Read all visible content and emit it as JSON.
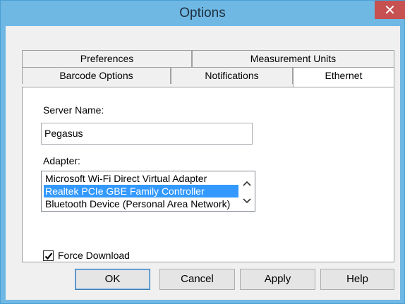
{
  "window": {
    "title": "Options",
    "close_symbol": "✕"
  },
  "tabs": {
    "row1": [
      {
        "label": "Preferences"
      },
      {
        "label": "Measurement Units"
      }
    ],
    "row2": [
      {
        "label": "Barcode Options"
      },
      {
        "label": "Notifications"
      },
      {
        "label": "Ethernet",
        "active": true
      }
    ]
  },
  "ethernet": {
    "server_name_label": "Server Name:",
    "server_name_value": "Pegasus",
    "adapter_label": "Adapter:",
    "adapter_items": [
      "Microsoft Wi-Fi Direct Virtual Adapter",
      "Realtek PCIe GBE Family Controller",
      "Bluetooth Device (Personal Area Network)"
    ],
    "selected_adapter": "Realtek PCIe GBE Family Controller",
    "force_download_label": "Force Download",
    "force_download_checked": true
  },
  "buttons": {
    "ok": "OK",
    "cancel": "Cancel",
    "apply": "Apply",
    "help": "Help"
  },
  "colors": {
    "frame": "#6fb8e4",
    "close": "#c75050",
    "selection": "#3399ff"
  }
}
